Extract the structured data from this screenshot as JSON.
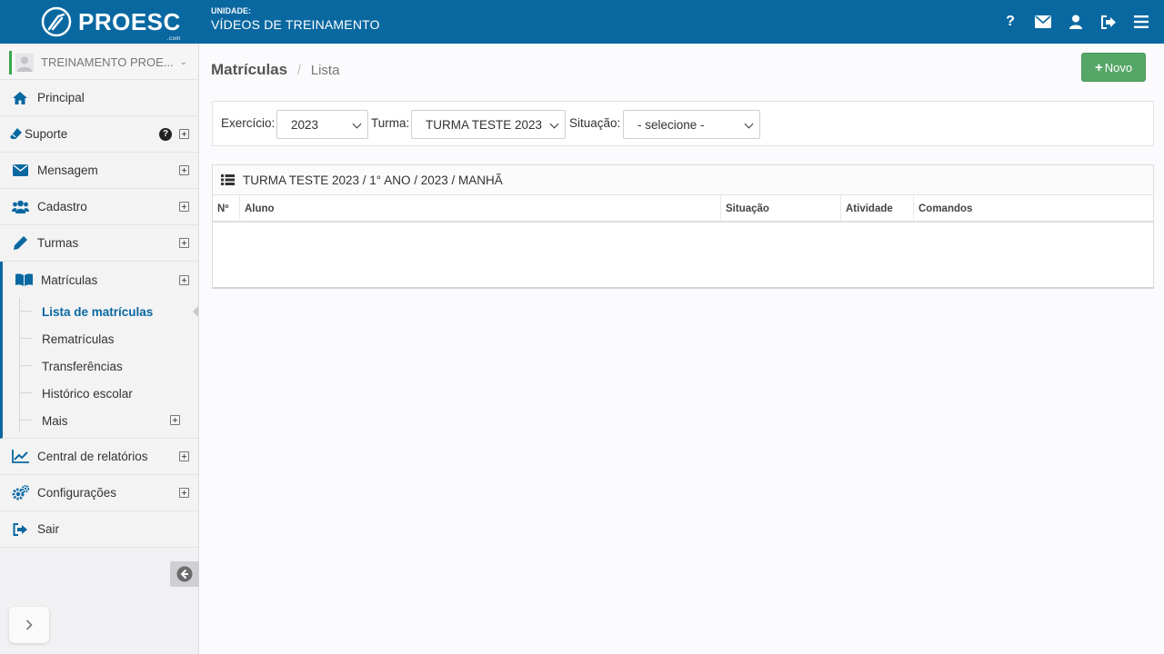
{
  "header": {
    "logo_text": "PROESC",
    "logo_sub": ".com",
    "unit_label": "UNIDADE:",
    "unit_name": "VÍDEOS DE TREINAMENTO",
    "icons": [
      "help-icon",
      "envelope-icon",
      "user-icon",
      "logout-icon",
      "menu-icon"
    ],
    "help_glyph": "?"
  },
  "sidebar": {
    "user_name": "TREINAMENTO PROE...",
    "items": {
      "principal": "Principal",
      "suporte": "Suporte",
      "mensagem": "Mensagem",
      "cadastro": "Cadastro",
      "turmas": "Turmas",
      "matriculas": "Matrículas",
      "relatorios": "Central de relatórios",
      "configuracoes": "Configurações",
      "sair": "Sair"
    },
    "sub_items": {
      "lista": "Lista de matrículas",
      "rematriculas": "Rematrículas",
      "transferencias": "Transferências",
      "historico": "Histórico escolar",
      "mais": "Mais"
    }
  },
  "main": {
    "breadcrumb": {
      "title": "Matrículas",
      "separator": "/",
      "current": "Lista"
    },
    "new_button": "Novo",
    "filters": {
      "exercicio_label": "Exercício:",
      "exercicio_value": "2023",
      "turma_label": "Turma:",
      "turma_value": "TURMA TESTE 2023",
      "situacao_label": "Situação:",
      "situacao_value": "- selecione -"
    },
    "table": {
      "title": "TURMA TESTE 2023 / 1° ANO / 2023 / MANHÃ",
      "columns": [
        "Nº",
        "Aluno",
        "Situação",
        "Atividade",
        "Comandos"
      ],
      "rows": []
    }
  },
  "colors": {
    "primary": "#0a68a1",
    "success": "#56a668",
    "active_link": "#0a68a1"
  }
}
